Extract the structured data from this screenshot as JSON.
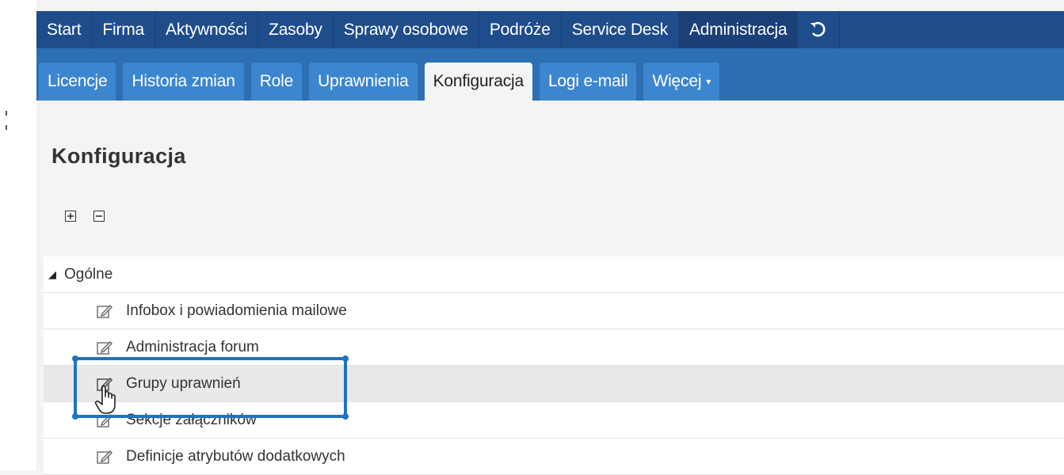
{
  "top_nav": {
    "items": [
      {
        "label": "Start"
      },
      {
        "label": "Firma"
      },
      {
        "label": "Aktywności"
      },
      {
        "label": "Zasoby"
      },
      {
        "label": "Sprawy osobowe"
      },
      {
        "label": "Podróże"
      },
      {
        "label": "Service Desk"
      },
      {
        "label": "Administracja",
        "active": true
      }
    ],
    "undo_icon": "undo-icon"
  },
  "sub_nav": {
    "tabs": [
      {
        "label": "Licencje"
      },
      {
        "label": "Historia zmian"
      },
      {
        "label": "Role"
      },
      {
        "label": "Uprawnienia"
      },
      {
        "label": "Konfiguracja",
        "active": true
      },
      {
        "label": "Logi e-mail"
      },
      {
        "label": "Więcej"
      }
    ]
  },
  "page": {
    "title": "Konfiguracja"
  },
  "tree": {
    "expand_all_icon": "plus-square-icon",
    "collapse_all_icon": "minus-square-icon",
    "group": {
      "label": "Ogólne",
      "icon": "triangle-down-icon"
    },
    "items": [
      {
        "label": "Infobox i powiadomienia mailowe",
        "icon": "edit-icon"
      },
      {
        "label": "Administracja forum",
        "icon": "edit-icon"
      },
      {
        "label": "Grupy uprawnień",
        "icon": "edit-icon",
        "hovered": true
      },
      {
        "label": "Sekcje załączników",
        "icon": "edit-icon"
      },
      {
        "label": "Definicje atrybutów dodatkowych",
        "icon": "edit-icon"
      }
    ]
  },
  "colors": {
    "top_nav_bg": "#1f4d8c",
    "sub_nav_bg": "#2d6fb3",
    "tab_bg": "#3c86cf",
    "highlight": "#1f73c1"
  }
}
